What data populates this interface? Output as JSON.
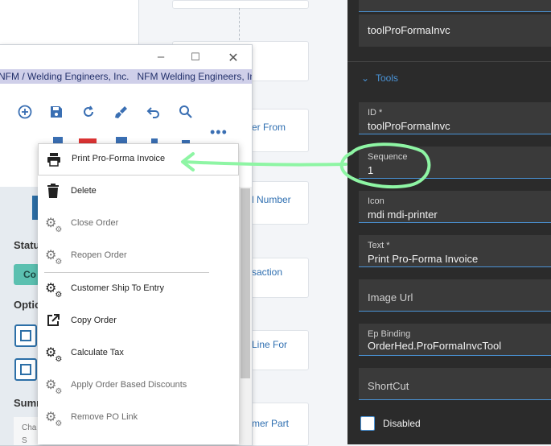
{
  "dialog": {
    "band_text": "NFM / Welding Engineers, Inc.   NFM Welding Engineers, Inc.",
    "left_labels": {
      "status": "Status",
      "options": "Optio",
      "summary": "Summ",
      "chart_partial": "Cha",
      "chart_partial2": "S",
      "status_badge": "Co"
    }
  },
  "canvas": {
    "labels": [
      "er From",
      "l Number",
      "saction",
      "Line For",
      "mer Part"
    ]
  },
  "menu": {
    "items": [
      {
        "label": "Print Pro-Forma Invoice",
        "icon": "printer-icon"
      },
      {
        "label": "Delete",
        "icon": "trash-icon"
      },
      {
        "label": "Close Order",
        "icon": "gears-icon"
      },
      {
        "label": "Reopen Order",
        "icon": "gears-icon"
      },
      {
        "label": "Customer Ship To Entry",
        "icon": "gears-icon"
      },
      {
        "label": "Copy Order",
        "icon": "external-link-icon"
      },
      {
        "label": "Calculate Tax",
        "icon": "gears-icon"
      },
      {
        "label": "Apply Order Based Discounts",
        "icon": "gears-icon"
      },
      {
        "label": "Remove PO Link",
        "icon": "gears-icon"
      }
    ]
  },
  "properties": {
    "top_value": "toolProFormaInvc",
    "section_title": "Tools",
    "fields": {
      "id": {
        "caption": "ID *",
        "value": "toolProFormaInvc"
      },
      "sequence": {
        "caption": "Sequence",
        "value": "1"
      },
      "icon": {
        "caption": "Icon",
        "value": "mdi mdi-printer"
      },
      "text": {
        "caption": "Text *",
        "value": "Print Pro-Forma Invoice"
      },
      "image_url": {
        "caption": "Image Url"
      },
      "ep_binding": {
        "caption": "Ep Binding",
        "value": "OrderHed.ProFormaInvcTool"
      },
      "shortcut": {
        "caption": "ShortCut"
      }
    },
    "disabled_label": "Disabled"
  },
  "colors": {
    "accent": "#4a93d6",
    "annotation": "#8ef5a4",
    "toolbar_icon": "#3a6fb3",
    "dark_panel": "#2b2b2b"
  }
}
